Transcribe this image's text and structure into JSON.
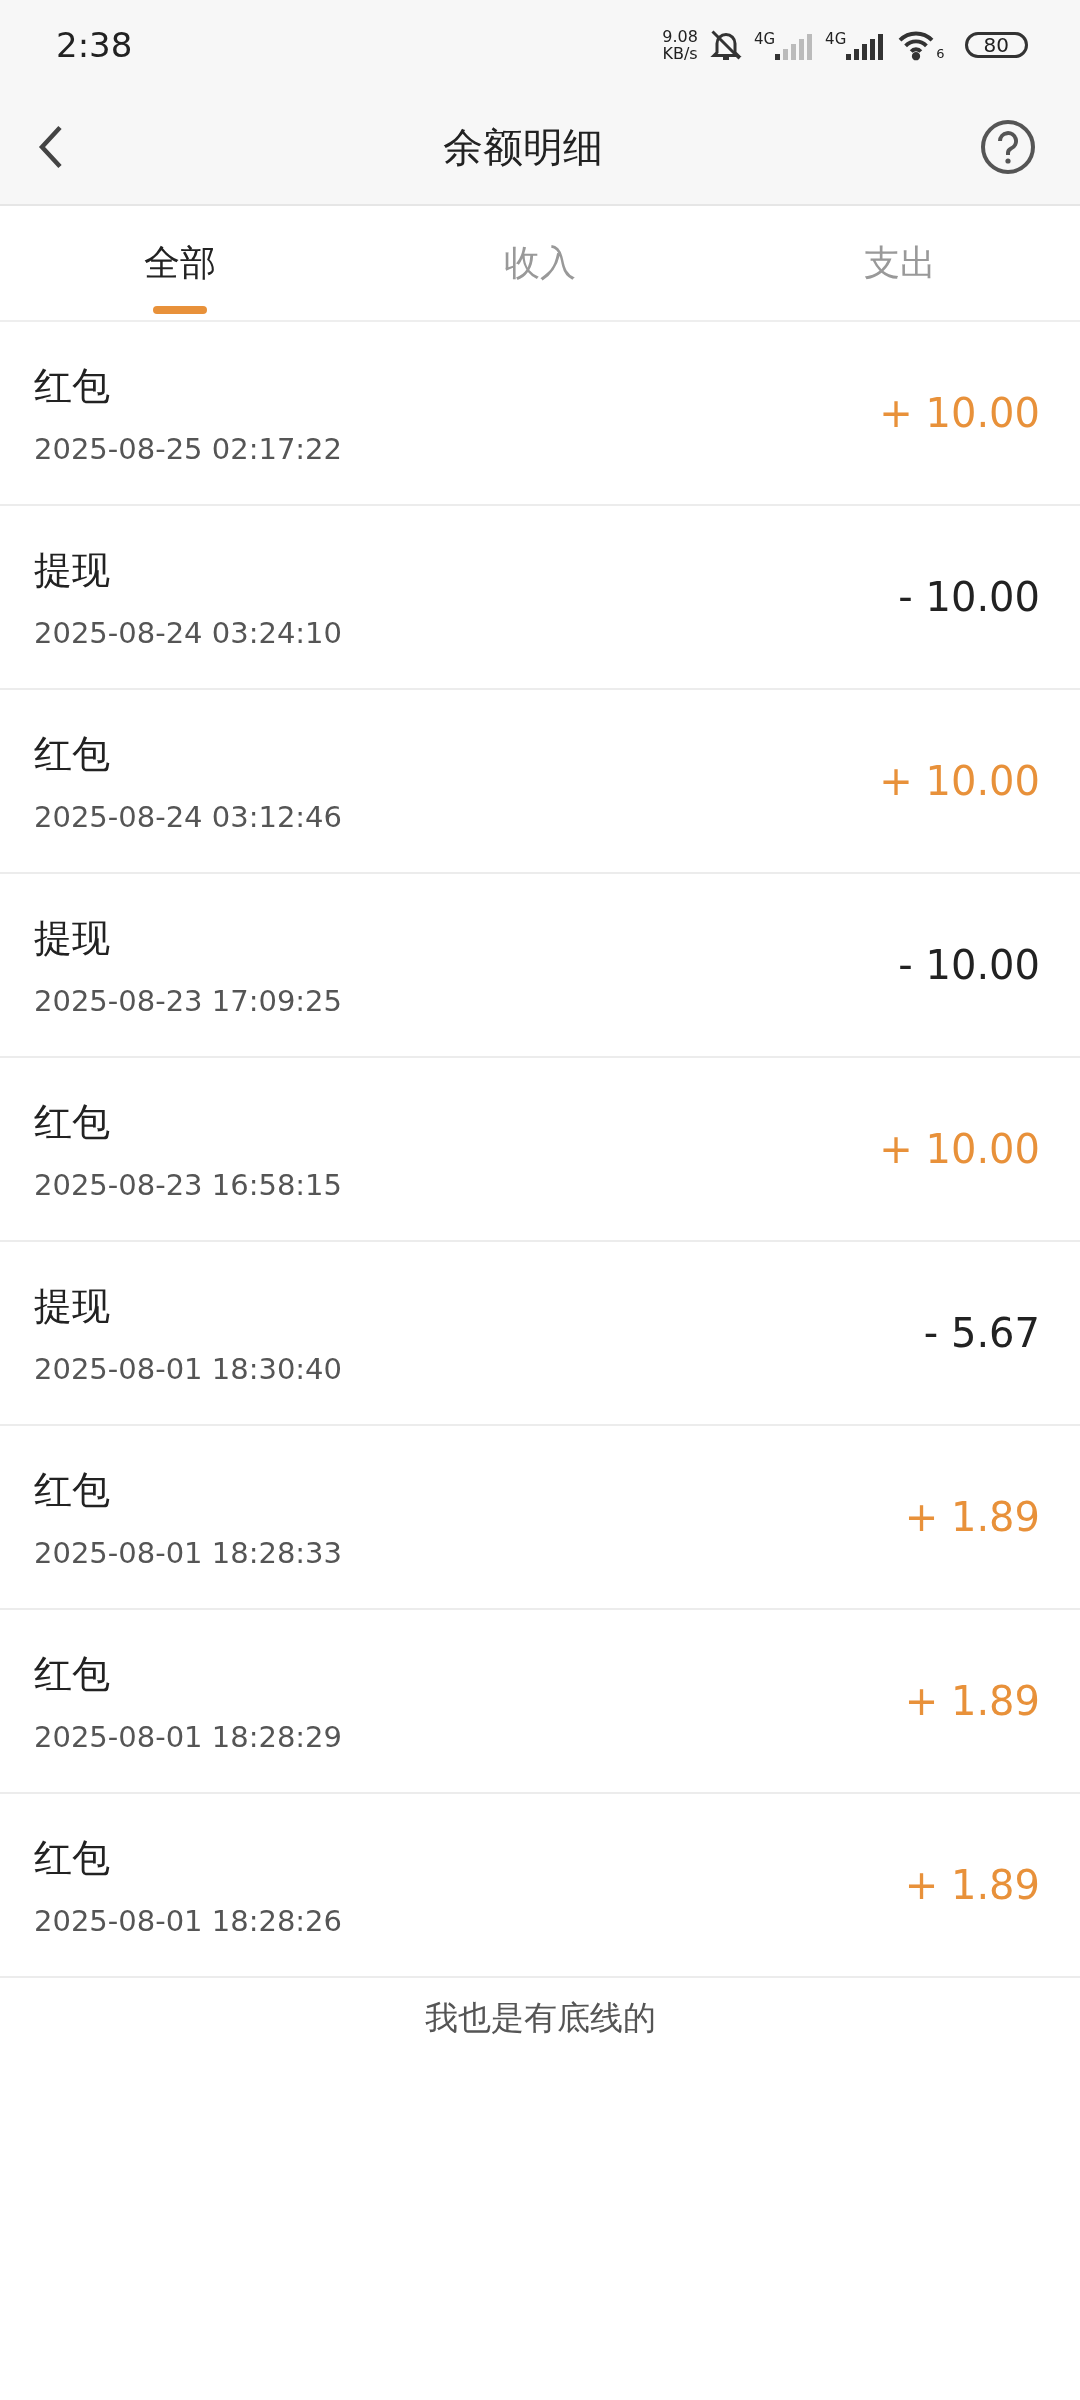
{
  "status_bar": {
    "time": "2:38",
    "net_speed": [
      "9.08",
      "KB/s"
    ],
    "signals": [
      {
        "label": "4G"
      },
      {
        "label": "4G"
      }
    ],
    "wifi_label": "6",
    "battery": "80"
  },
  "header": {
    "title": "余额明细"
  },
  "tabs": [
    {
      "label": "全部",
      "selected": true
    },
    {
      "label": "收入",
      "selected": false
    },
    {
      "label": "支出",
      "selected": false
    }
  ],
  "records": [
    {
      "title": "红包",
      "time": "2025-08-25 02:17:22",
      "amount": "+ 10.00",
      "kind": "income"
    },
    {
      "title": "提现",
      "time": "2025-08-24 03:24:10",
      "amount": "- 10.00",
      "kind": "expense"
    },
    {
      "title": "红包",
      "time": "2025-08-24 03:12:46",
      "amount": "+ 10.00",
      "kind": "income"
    },
    {
      "title": "提现",
      "time": "2025-08-23 17:09:25",
      "amount": "- 10.00",
      "kind": "expense"
    },
    {
      "title": "红包",
      "time": "2025-08-23 16:58:15",
      "amount": "+ 10.00",
      "kind": "income"
    },
    {
      "title": "提现",
      "time": "2025-08-01 18:30:40",
      "amount": "- 5.67",
      "kind": "expense"
    },
    {
      "title": "红包",
      "time": "2025-08-01 18:28:33",
      "amount": "+ 1.89",
      "kind": "income"
    },
    {
      "title": "红包",
      "time": "2025-08-01 18:28:29",
      "amount": "+ 1.89",
      "kind": "income"
    },
    {
      "title": "红包",
      "time": "2025-08-01 18:28:26",
      "amount": "+ 1.89",
      "kind": "income"
    }
  ],
  "footer": "我也是有底线的"
}
